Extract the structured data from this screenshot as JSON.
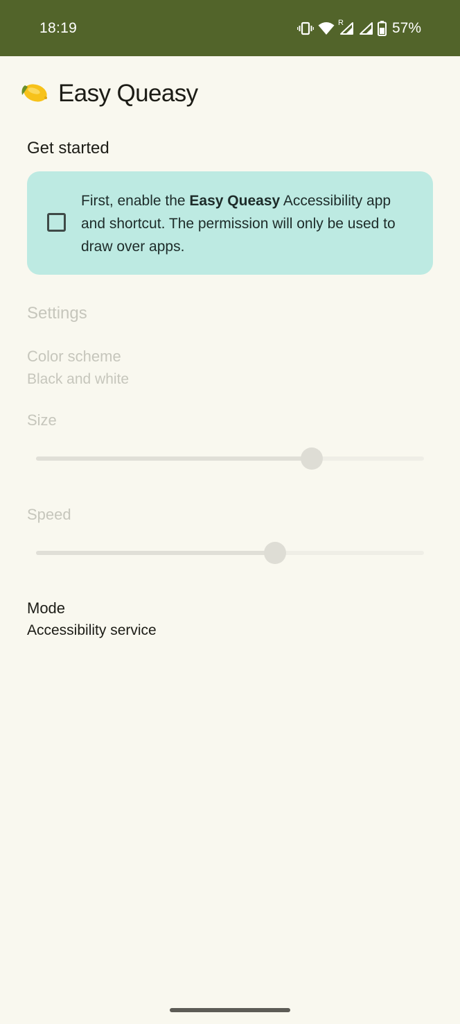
{
  "status_bar": {
    "time": "18:19",
    "roaming_indicator": "R",
    "battery_percent": "57%",
    "icons": [
      "vibrate-icon",
      "wifi-icon",
      "signal-icon",
      "signal-icon",
      "battery-icon"
    ]
  },
  "app": {
    "title": "Easy Queasy",
    "logo_icon": "lemon-icon"
  },
  "get_started": {
    "heading": "Get started",
    "card": {
      "text_before": "First, enable the ",
      "text_bold": "Easy Queasy",
      "text_after": " Accessibility app and shortcut. The permission will only be used to draw over apps.",
      "checked": false
    }
  },
  "settings": {
    "heading": "Settings",
    "color_scheme": {
      "label": "Color scheme",
      "value": "Black and white"
    },
    "size": {
      "label": "Size",
      "level": 0.71
    },
    "speed": {
      "label": "Speed",
      "level": 0.616
    },
    "mode": {
      "label": "Mode",
      "value": "Accessibility service"
    }
  },
  "colors": {
    "status_bar": "#52642a",
    "background": "#f9f8ef",
    "card": "#bdeae2",
    "disabled_text": "#c6c6bc"
  }
}
